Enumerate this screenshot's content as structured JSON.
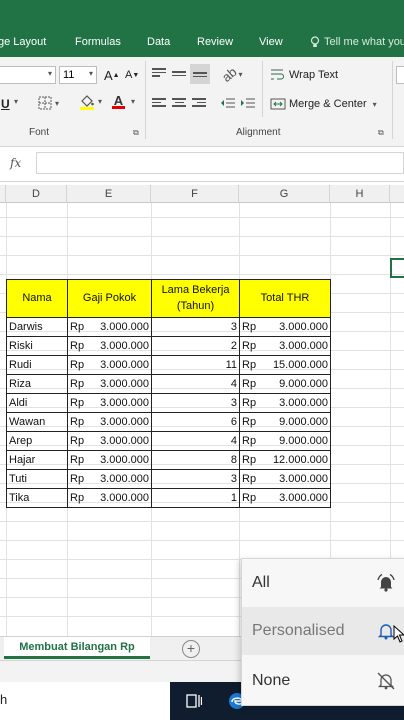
{
  "ribbon_tabs": [
    "ge Layout",
    "Formulas",
    "Data",
    "Review",
    "View"
  ],
  "tell_me": "Tell me what you",
  "font": {
    "size": "11",
    "grow_label": "A",
    "shrink_label": "A",
    "underline": "U"
  },
  "alignment": {
    "wrap_text": "Wrap Text",
    "merge_center": "Merge & Center"
  },
  "groups": {
    "font": "Font",
    "alignment": "Alignment"
  },
  "formula_bar": {
    "fx": "fx",
    "value": ""
  },
  "columns": [
    "D",
    "E",
    "F",
    "G",
    "H"
  ],
  "table": {
    "headers": [
      "Nama",
      "Gaji Pokok",
      "Lama Bekerja (Tahun)",
      "Total THR"
    ],
    "rows": [
      {
        "nama": "Darwis",
        "gaji": "3.000.000",
        "lama": "3",
        "thr": "3.000.000"
      },
      {
        "nama": "Riski",
        "gaji": "3.000.000",
        "lama": "2",
        "thr": "3.000.000"
      },
      {
        "nama": "Rudi",
        "gaji": "3.000.000",
        "lama": "11",
        "thr": "15.000.000"
      },
      {
        "nama": "Riza",
        "gaji": "3.000.000",
        "lama": "4",
        "thr": "9.000.000"
      },
      {
        "nama": "Aldi",
        "gaji": "3.000.000",
        "lama": "3",
        "thr": "3.000.000"
      },
      {
        "nama": "Wawan",
        "gaji": "3.000.000",
        "lama": "6",
        "thr": "9.000.000"
      },
      {
        "nama": "Arep",
        "gaji": "3.000.000",
        "lama": "4",
        "thr": "9.000.000"
      },
      {
        "nama": "Hajar",
        "gaji": "3.000.000",
        "lama": "8",
        "thr": "12.000.000"
      },
      {
        "nama": "Tuti",
        "gaji": "3.000.000",
        "lama": "3",
        "thr": "3.000.000"
      },
      {
        "nama": "Tika",
        "gaji": "3.000.000",
        "lama": "1",
        "thr": "3.000.000"
      }
    ],
    "currency": "Rp"
  },
  "sheet_tab": "Membuat Bilangan Rp",
  "add_sheet": "+",
  "search_tail": "h",
  "notification_menu": [
    {
      "label": "All",
      "icon": "bell-ringing-icon"
    },
    {
      "label": "Personalised",
      "icon": "bell-icon"
    },
    {
      "label": "None",
      "icon": "bell-off-icon"
    }
  ],
  "colors": {
    "excel_green": "#217346",
    "header_yellow": "#ffff00",
    "taskbar": "#0f1d2f"
  }
}
